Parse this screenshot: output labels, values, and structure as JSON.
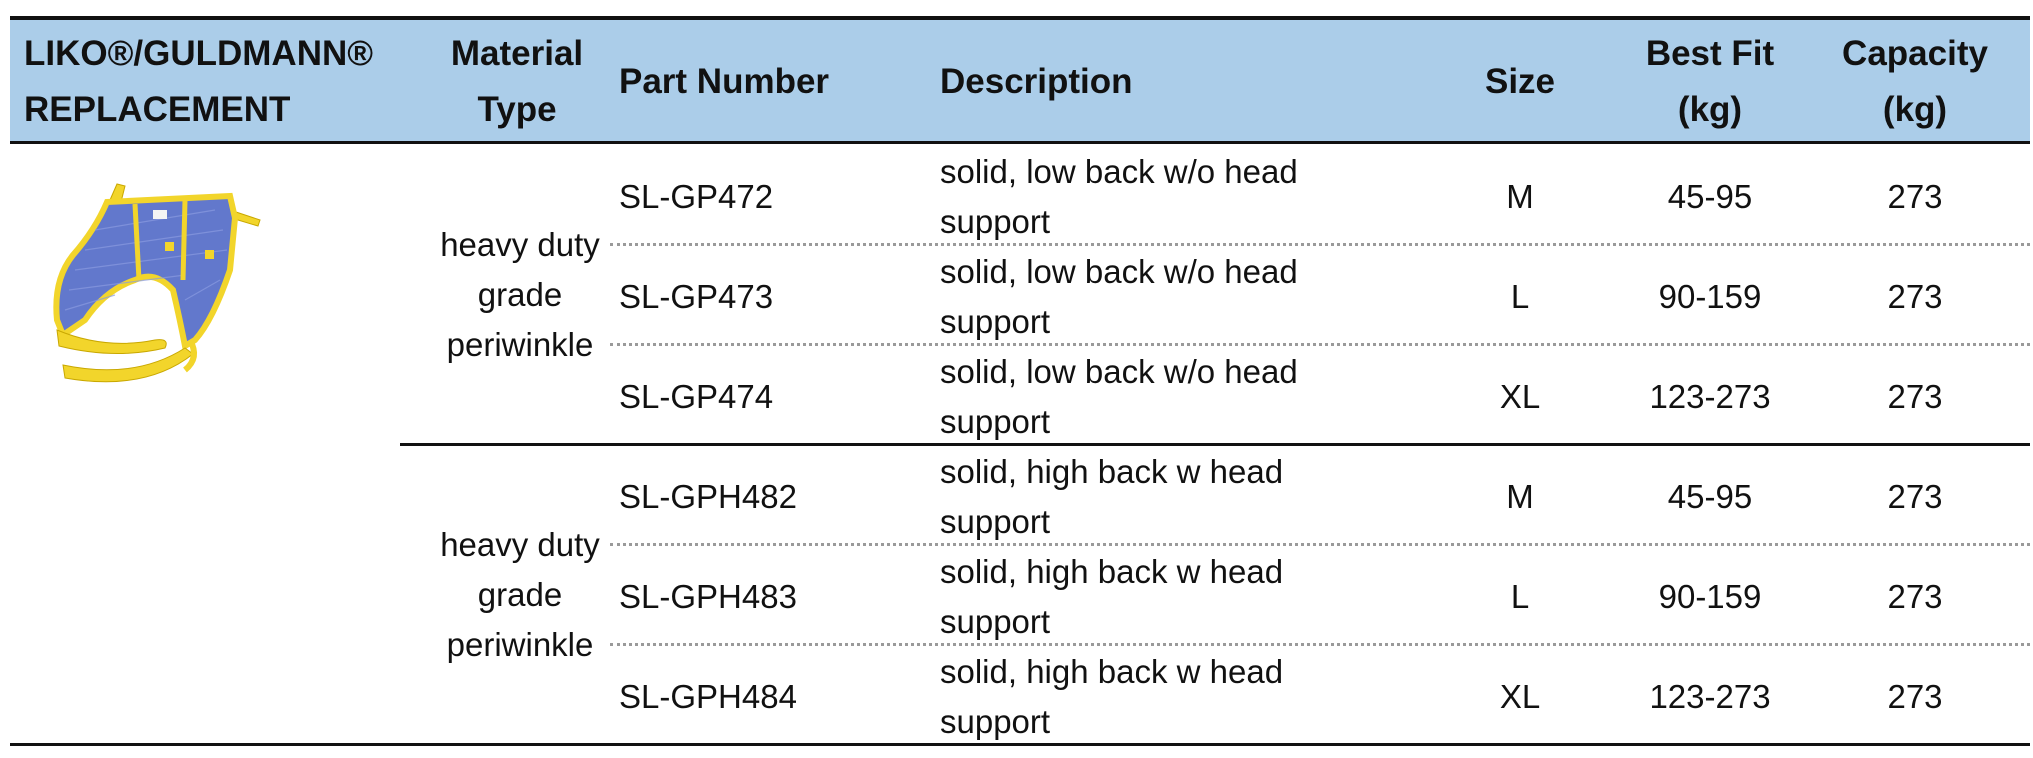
{
  "header": {
    "brand_line1": "LIKO®/GULDMANN®",
    "brand_line2": "REPLACEMENT",
    "material_line1": "Material",
    "material_line2": "Type",
    "part_number": "Part Number",
    "description": "Description",
    "size": "Size",
    "bestfit_line1": "Best Fit",
    "bestfit_line2": "(kg)",
    "capacity_line1": "Capacity",
    "capacity_line2": "(kg)"
  },
  "groups": [
    {
      "material": [
        "heavy duty",
        "grade",
        "periwinkle"
      ],
      "rows": [
        {
          "part": "SL-GP472",
          "desc1": "solid, low back w/o head",
          "desc2": "support",
          "size": "M",
          "fit": "45-95",
          "cap": "273"
        },
        {
          "part": "SL-GP473",
          "desc1": "solid, low back w/o head",
          "desc2": "support",
          "size": "L",
          "fit": "90-159",
          "cap": "273"
        },
        {
          "part": "SL-GP474",
          "desc1": "solid, low back w/o head",
          "desc2": "support",
          "size": "XL",
          "fit": "123-273",
          "cap": "273"
        }
      ]
    },
    {
      "material": [
        "heavy duty",
        "grade",
        "periwinkle"
      ],
      "rows": [
        {
          "part": "SL-GPH482",
          "desc1": "solid, high back w head",
          "desc2": "support",
          "size": "M",
          "fit": "45-95",
          "cap": "273"
        },
        {
          "part": "SL-GPH483",
          "desc1": "solid, high back w head",
          "desc2": "support",
          "size": "L",
          "fit": "90-159",
          "cap": "273"
        },
        {
          "part": "SL-GPH484",
          "desc1": "solid, high back w head",
          "desc2": "support",
          "size": "XL",
          "fit": "123-273",
          "cap": "273"
        }
      ]
    }
  ],
  "product_image": {
    "icon": "sling-image",
    "colors": {
      "body": "#5f74c9",
      "trim": "#f2d52b"
    }
  }
}
